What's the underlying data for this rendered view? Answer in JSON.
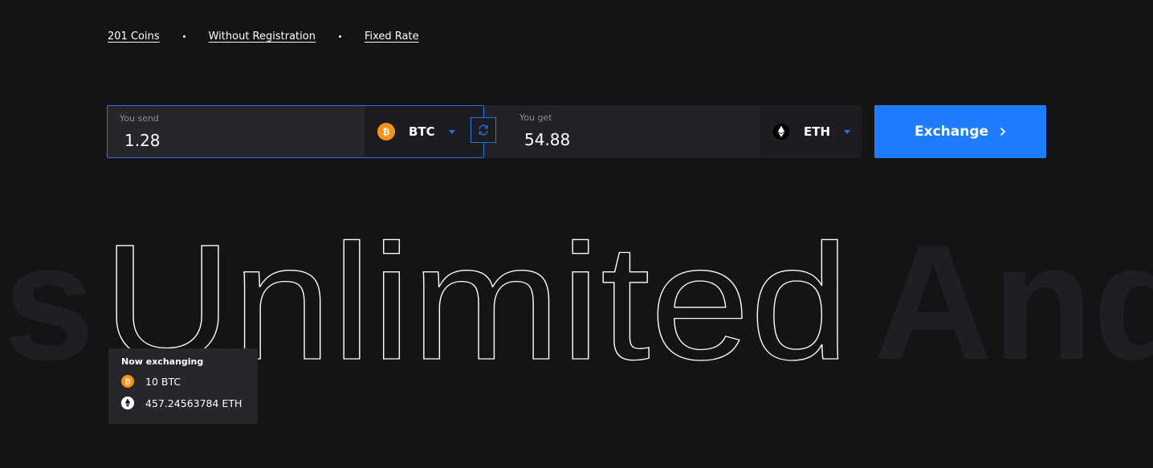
{
  "features": {
    "coins": "201 Coins",
    "registration": "Without Registration",
    "rate": "Fixed Rate"
  },
  "exchange": {
    "send": {
      "label": "You send",
      "amount": "1.28",
      "ticker": "BTC",
      "icon": "bitcoin-icon"
    },
    "get": {
      "label": "You get",
      "amount": "54.88",
      "ticker": "ETH",
      "icon": "ethereum-icon"
    },
    "swap_icon": "swap-icon",
    "button_label": "Exchange",
    "accent_color": "#1f7dfd"
  },
  "headline": {
    "left_fragment": "s",
    "main_word": "Unlimited",
    "right_fragment": "And"
  },
  "now_exchanging": {
    "title": "Now exchanging",
    "from": "10 BTC",
    "to": "457.24563784 ETH"
  },
  "colors": {
    "background": "#141416",
    "field": "#26262b",
    "btc": "#f7931a"
  }
}
